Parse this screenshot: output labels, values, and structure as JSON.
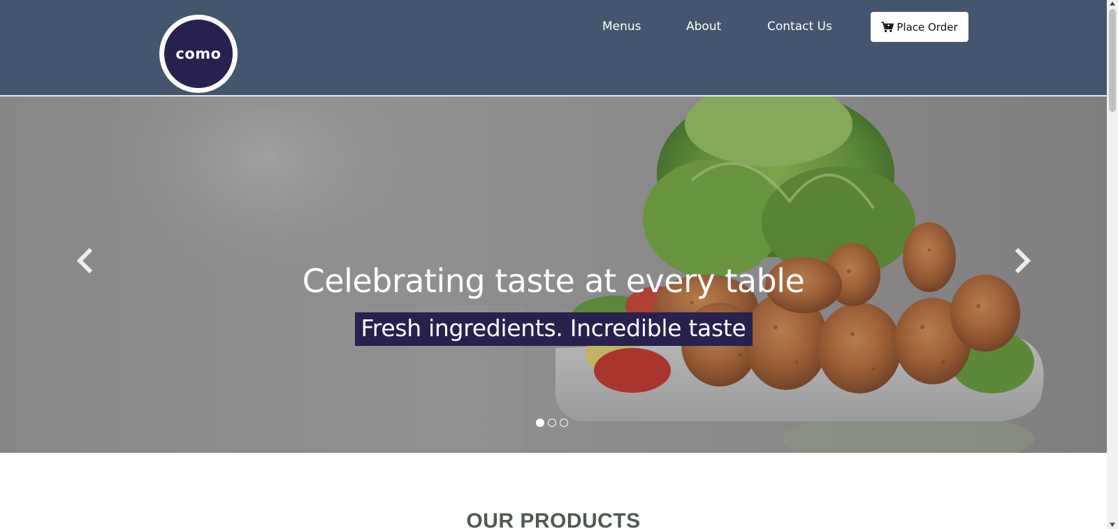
{
  "header": {
    "logo_text": "como",
    "nav": [
      {
        "label": "Menus"
      },
      {
        "label": "About"
      },
      {
        "label": "Contact Us"
      }
    ],
    "order_button": {
      "label": "Place Order",
      "icon": "cart-icon"
    }
  },
  "hero": {
    "headline": "Celebrating taste at every table",
    "subline": "Fresh ingredients. Incredible taste",
    "prev_icon": "chevron-left-icon",
    "next_icon": "chevron-right-icon",
    "slide_count": 3,
    "active_slide": 1
  },
  "products": {
    "title": "OUR PRODUCTS"
  },
  "colors": {
    "header_bg": "#44566e",
    "brand_dark": "#27214f",
    "section_title": "#4e5a50"
  }
}
